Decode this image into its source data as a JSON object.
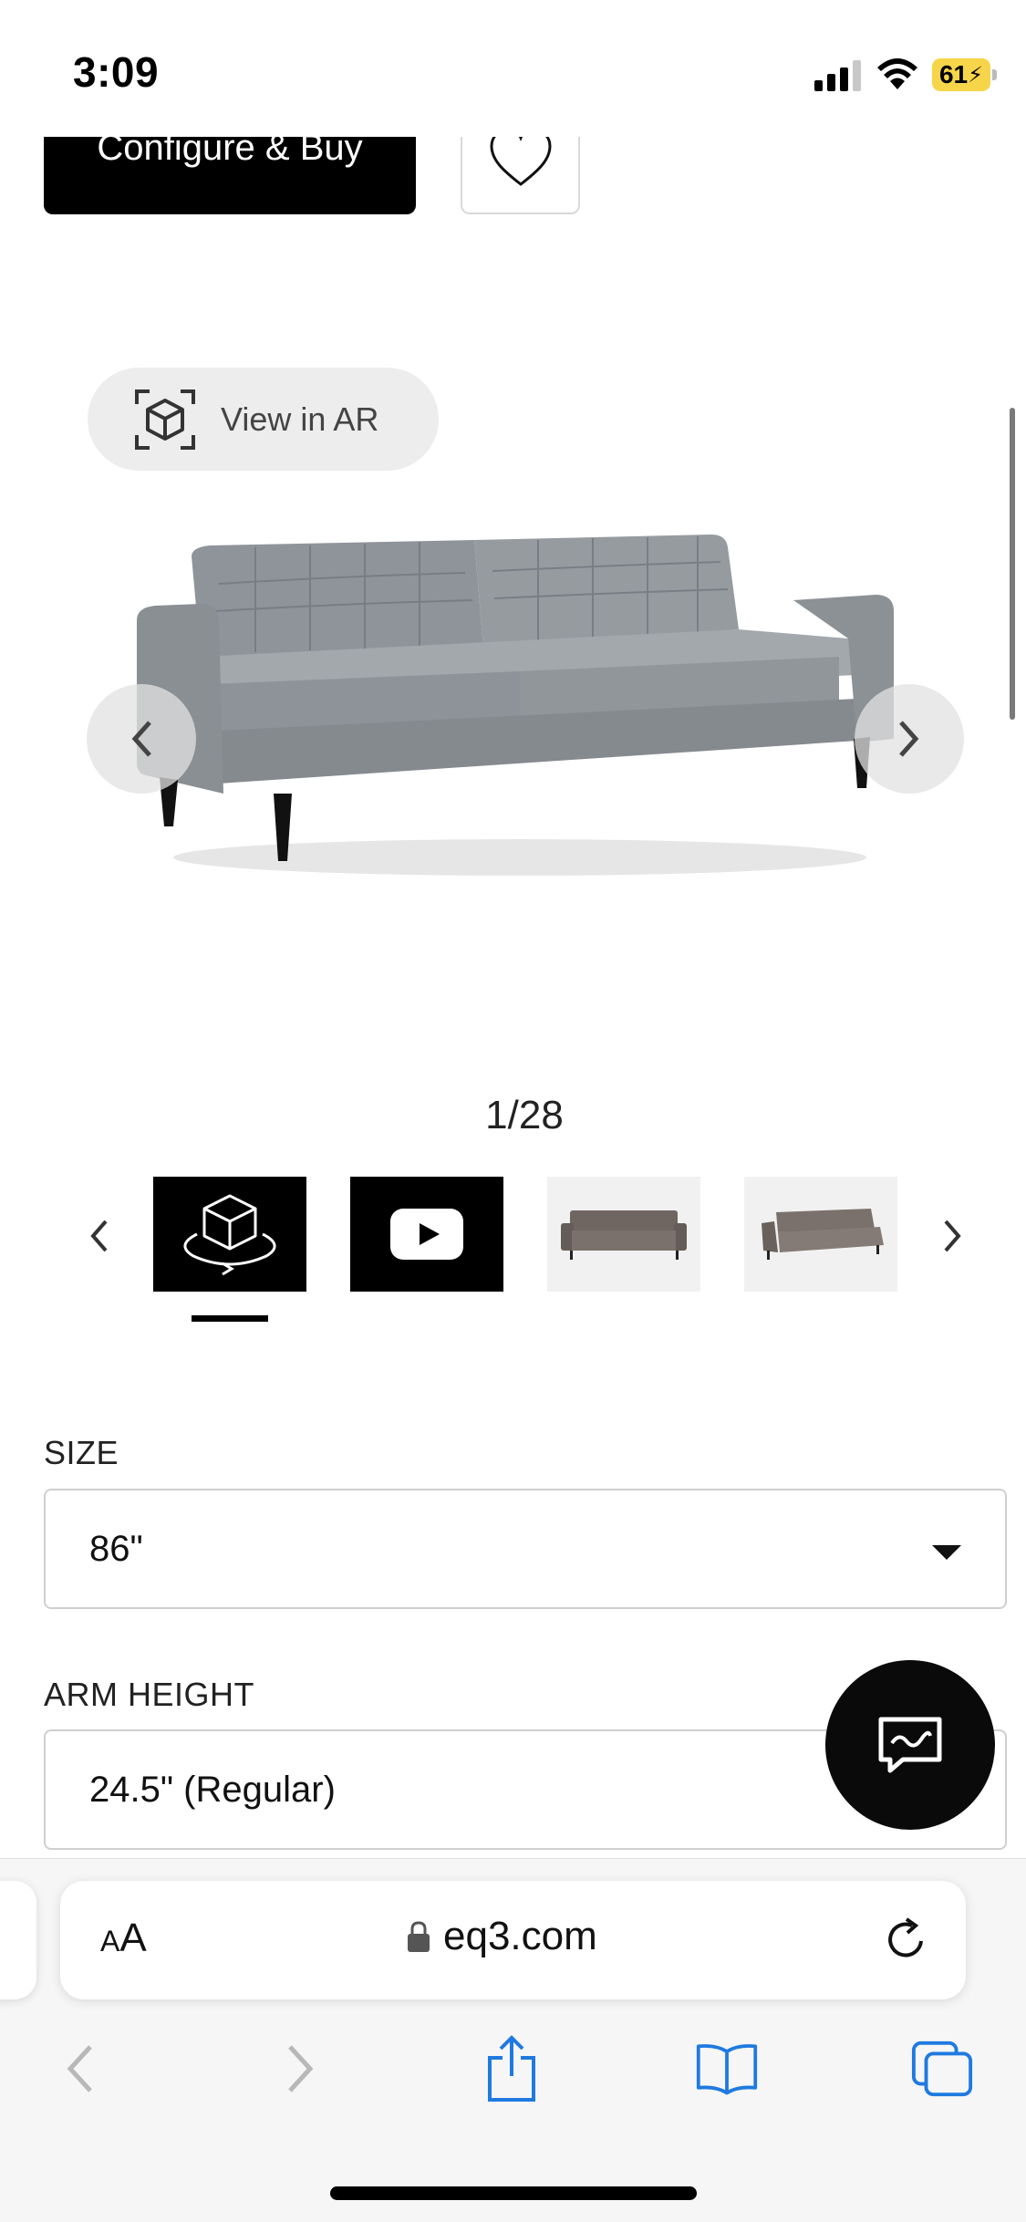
{
  "status_bar": {
    "time": "3:09",
    "battery": "61"
  },
  "product": {
    "configure_label": "Configure & Buy",
    "ar_label": "View in AR",
    "gallery_counter": "1/28"
  },
  "options": {
    "size": {
      "label": "SIZE",
      "value": "86\""
    },
    "arm_height": {
      "label": "ARM HEIGHT",
      "value": "24.5\" (Regular)"
    }
  },
  "browser": {
    "aa_small": "A",
    "aa_large": "A",
    "url": "eq3.com"
  },
  "colors": {
    "button_black": "#000000",
    "battery_yellow": "#f7d54a",
    "ios_blue": "#1f7ae0",
    "sofa_grey": "#8c9196"
  },
  "icons": [
    "heart-icon",
    "ar-cube-icon",
    "chevron-left-icon",
    "chevron-right-icon",
    "3d-view-icon",
    "play-icon",
    "chat-icon",
    "lock-icon",
    "reload-icon",
    "back-icon",
    "forward-icon",
    "share-icon",
    "bookmarks-icon",
    "tabs-icon"
  ]
}
